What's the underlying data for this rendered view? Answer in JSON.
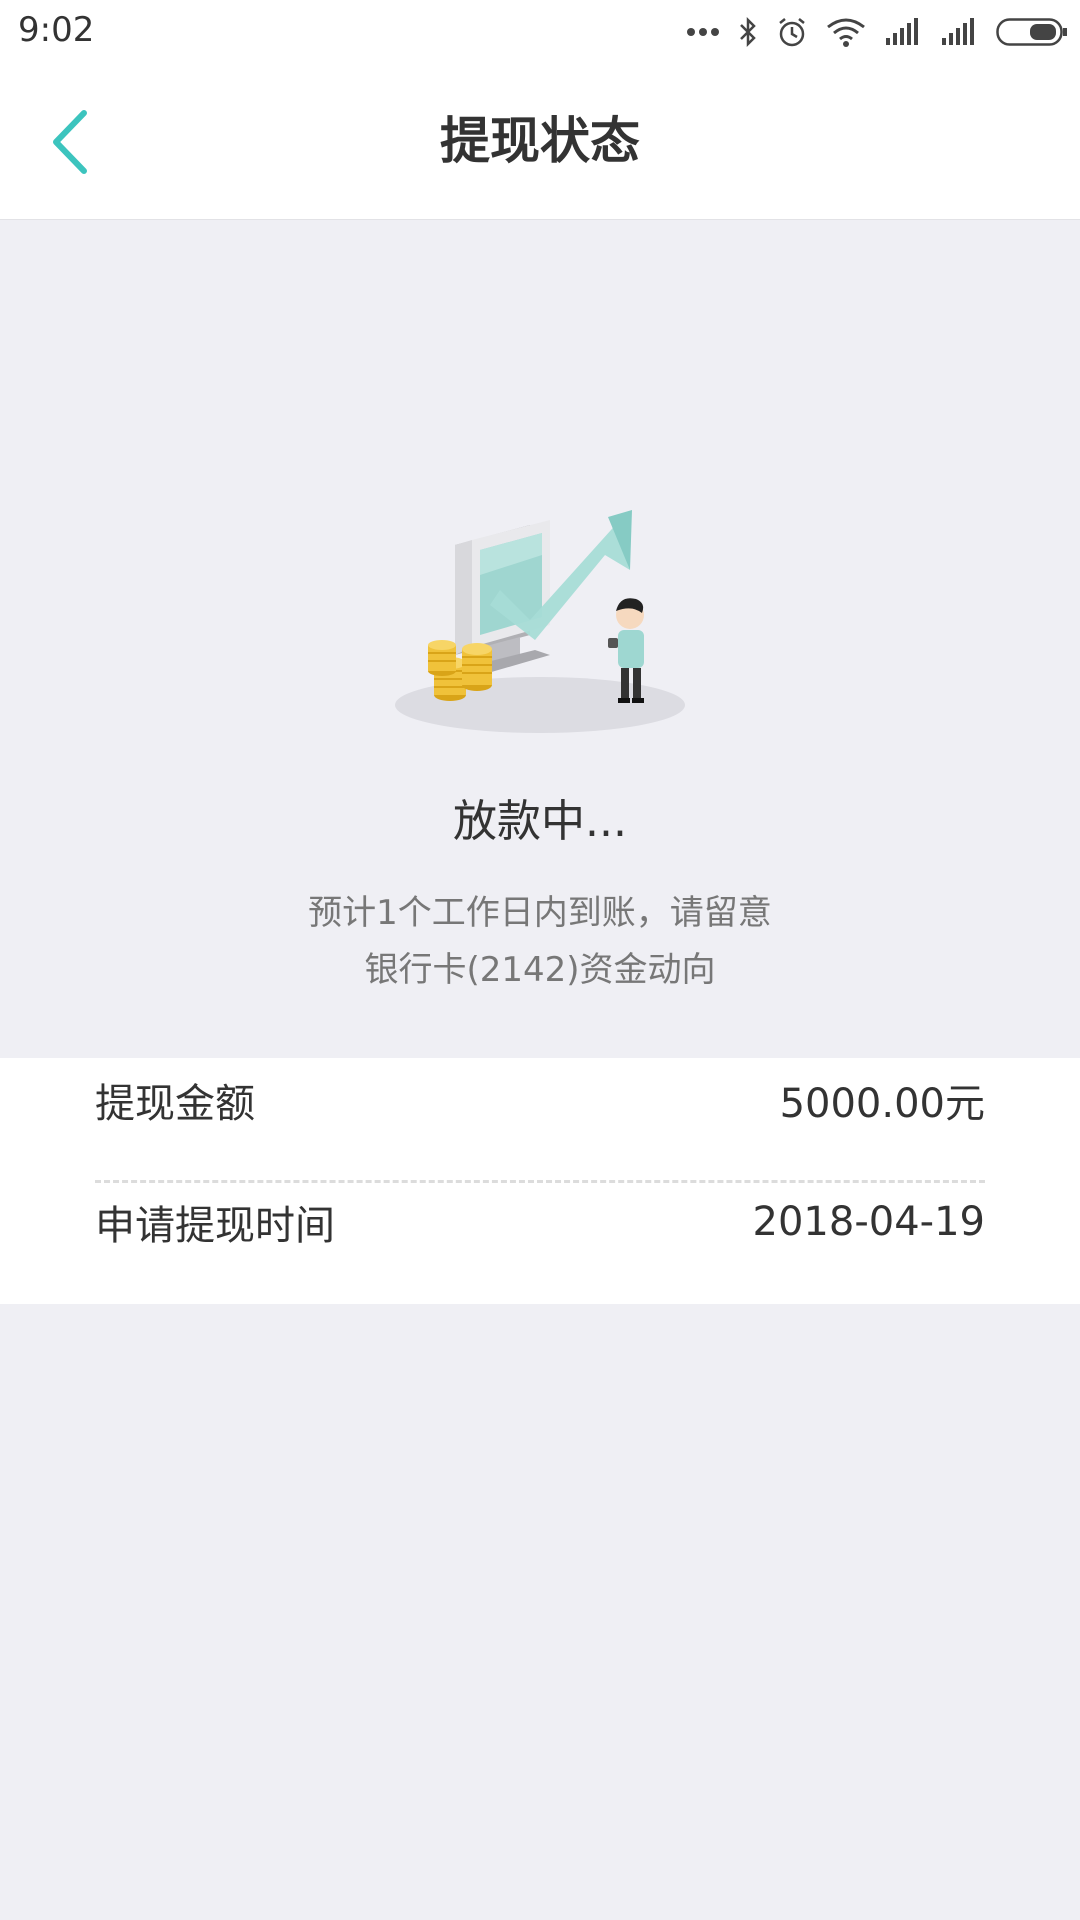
{
  "status_bar": {
    "time": "9:02",
    "icons": [
      "more-dots-icon",
      "bluetooth-icon",
      "alarm-icon",
      "wifi-icon",
      "signal-icon",
      "signal-icon",
      "battery-icon"
    ]
  },
  "nav": {
    "title": "提现状态",
    "back_icon": "chevron-left-icon",
    "accent_color": "#3cc4be"
  },
  "status": {
    "title": "放款中...",
    "description_line1": "预计1个工作日内到账，请留意",
    "description_line2": "银行卡(2142)资金动向",
    "illustration": "withdrawal-processing-illustration"
  },
  "details": {
    "amount_label": "提现金额",
    "amount_value": "5000.00元",
    "date_label": "申请提现时间",
    "date_value": "2018-04-19"
  }
}
